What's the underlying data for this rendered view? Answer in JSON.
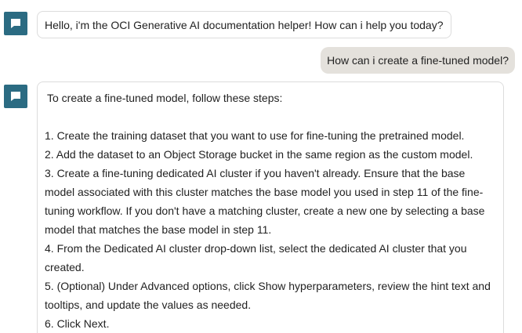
{
  "messages": [
    {
      "role": "assistant",
      "icon": "chat-bubble-icon",
      "text": "Hello, i'm the OCI Generative AI documentation helper! How can i help you today?"
    },
    {
      "role": "user",
      "text": "How can i create a fine-tuned model?"
    },
    {
      "role": "assistant",
      "icon": "chat-bubble-icon",
      "intro": "To create a fine-tuned model, follow these steps:",
      "steps": [
        "1. Create the training dataset that you want to use for fine-tuning the pretrained model.",
        "2. Add the dataset to an Object Storage bucket in the same region as the custom model.",
        "3. Create a fine-tuning dedicated AI cluster if you haven't already. Ensure that the base model associated with this cluster matches the base model you used in step 11 of the fine-tuning workflow. If you don't have a matching cluster, create a new one by selecting a base model that matches the base model in step 11.",
        "4. From the Dedicated AI cluster drop-down list, select the dedicated AI cluster that you created.",
        "5. (Optional) Under Advanced options, click Show hyperparameters, review the hint text and tooltips, and update the values as needed.",
        "6. Click Next."
      ]
    }
  ],
  "colors": {
    "avatar": "#2b6b82",
    "user_bubble": "#e4e1dc",
    "bot_border": "#dcdcdc"
  }
}
